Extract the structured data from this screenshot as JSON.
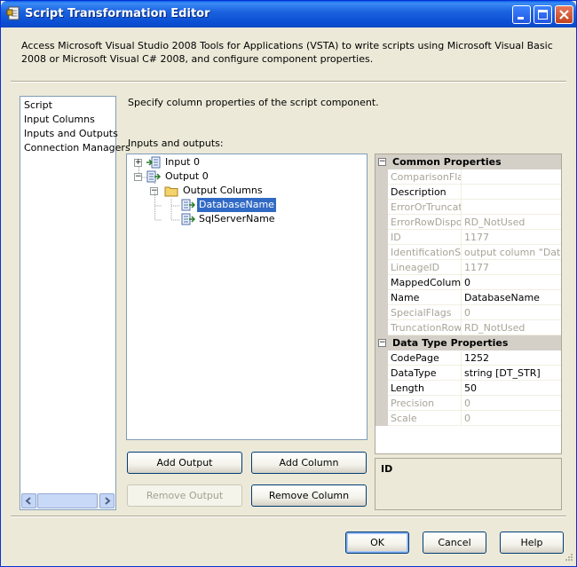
{
  "window": {
    "title": "Script Transformation Editor",
    "description": "Access Microsoft Visual Studio 2008 Tools for Applications (VSTA) to write scripts using Microsoft Visual Basic 2008 or Microsoft Visual C# 2008, and configure component properties."
  },
  "nav": {
    "items": [
      "Script",
      "Input Columns",
      "Inputs and Outputs",
      "Connection Managers"
    ]
  },
  "main": {
    "heading": "Specify column properties of the script component.",
    "io_label": "Inputs and outputs:"
  },
  "tree": {
    "input0": "Input 0",
    "output0": "Output 0",
    "output_columns": "Output Columns",
    "col1": "DatabaseName",
    "col2": "SqlServerName"
  },
  "properties": {
    "common_title": "Common Properties",
    "common": [
      {
        "name": "ComparisonFlags",
        "value": "",
        "readonly": true
      },
      {
        "name": "Description",
        "value": "",
        "readonly": false
      },
      {
        "name": "ErrorOrTruncationOperation",
        "value": "",
        "readonly": true
      },
      {
        "name": "ErrorRowDisposition",
        "value": "RD_NotUsed",
        "readonly": true
      },
      {
        "name": "ID",
        "value": "1177",
        "readonly": true
      },
      {
        "name": "IdentificationString",
        "value": "output column \"DatabaseName\"",
        "readonly": true
      },
      {
        "name": "LineageID",
        "value": "1177",
        "readonly": true
      },
      {
        "name": "MappedColumnID",
        "value": "0",
        "readonly": false
      },
      {
        "name": "Name",
        "value": "DatabaseName",
        "readonly": false
      },
      {
        "name": "SpecialFlags",
        "value": "0",
        "readonly": true
      },
      {
        "name": "TruncationRowDisposition",
        "value": "RD_NotUsed",
        "readonly": true
      }
    ],
    "datatype_title": "Data Type Properties",
    "datatype": [
      {
        "name": "CodePage",
        "value": "1252",
        "readonly": false
      },
      {
        "name": "DataType",
        "value": "string [DT_STR]",
        "readonly": false
      },
      {
        "name": "Length",
        "value": "50",
        "readonly": false
      },
      {
        "name": "Precision",
        "value": "0",
        "readonly": true
      },
      {
        "name": "Scale",
        "value": "0",
        "readonly": true
      }
    ],
    "help_title": "ID"
  },
  "buttons": {
    "add_output": "Add Output",
    "add_column": "Add Column",
    "remove_output": "Remove Output",
    "remove_column": "Remove Column",
    "ok": "OK",
    "cancel": "Cancel",
    "help": "Help"
  },
  "colors": {
    "titlebar": "#0a4fd4",
    "selection": "#316ac5",
    "dialog_bg": "#ece9d8"
  }
}
